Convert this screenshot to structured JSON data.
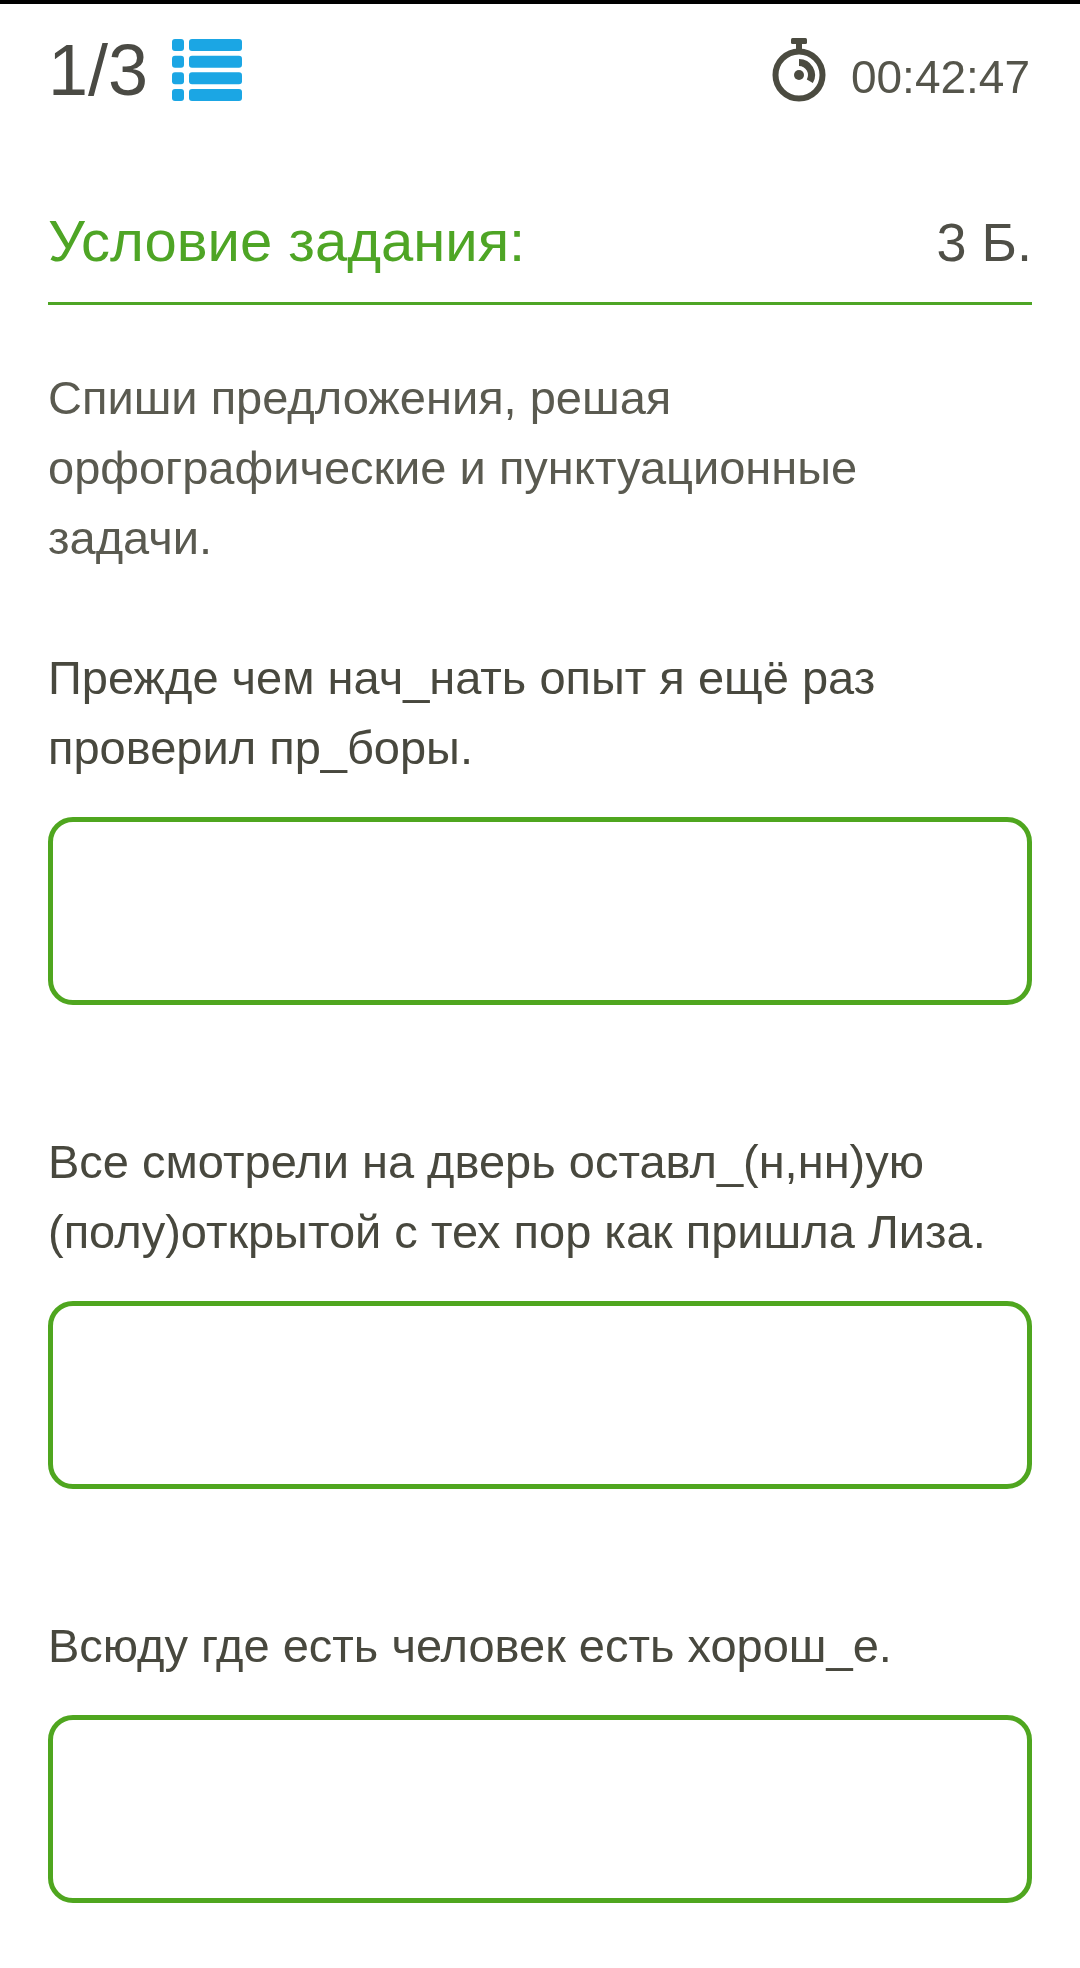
{
  "header": {
    "progress": "1/3",
    "timer": "00:42:47"
  },
  "task": {
    "title": "Условие задания:",
    "points": "3 Б.",
    "instruction": "Спиши предложения, решая орфографические и пунктуационные задачи."
  },
  "questions": [
    {
      "sentence": "Прежде чем нач_нать опыт я ещё раз проверил пр_боры."
    },
    {
      "sentence": "Все смотрели на дверь оставл_(н,нн)ую (полу)открытой с тех пор как пришла Лиза."
    },
    {
      "sentence": "Всюду где есть человек есть хорош_е."
    }
  ]
}
